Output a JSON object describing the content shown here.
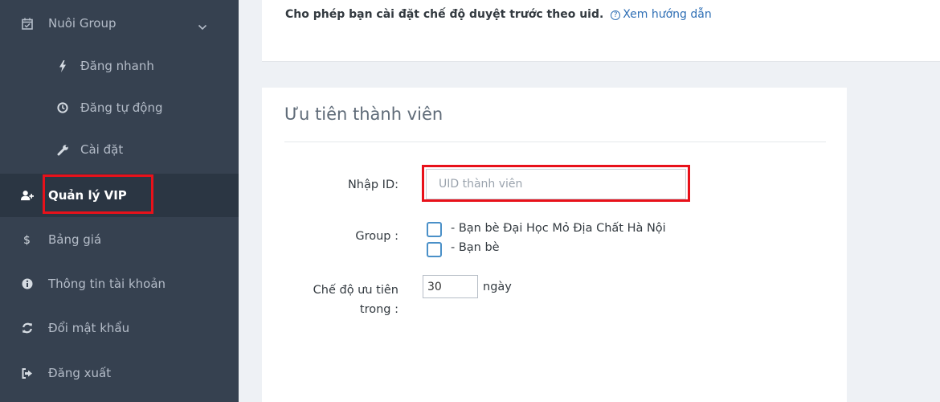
{
  "sidebar": {
    "group_menu": {
      "label": "Nuôi Group",
      "icon": "calendar-check-icon"
    },
    "sub_items": [
      {
        "label": "Đăng nhanh",
        "icon": "bolt-icon"
      },
      {
        "label": "Đăng tự động",
        "icon": "clock-icon"
      },
      {
        "label": "Cài đặt",
        "icon": "wrench-icon"
      }
    ],
    "active_item": {
      "label": "Quản lý VIP",
      "icon": "user-plus-icon"
    },
    "items": [
      {
        "label": "Bảng giá",
        "icon": "dollar-icon"
      },
      {
        "label": "Thông tin tài khoản",
        "icon": "info-circle-icon"
      },
      {
        "label": "Đổi mật khẩu",
        "icon": "refresh-icon"
      },
      {
        "label": "Đăng xuất",
        "icon": "sign-out-icon"
      }
    ]
  },
  "top_card": {
    "description": "Cho phép bạn cài đặt chế độ duyệt trước theo uid.",
    "help_link": "Xem hướng dẫn"
  },
  "form": {
    "title": "Ưu tiên thành viên",
    "id_label": "Nhập ID:",
    "id_placeholder": "UID thành viên",
    "group_label": "Group :",
    "groups": [
      {
        "label": "- Bạn bè Đại Học Mỏ Địa Chất Hà Nội",
        "checked": false
      },
      {
        "label": "- Bạn bè",
        "checked": false
      }
    ],
    "priority_label_line1": "Chế độ ưu tiên",
    "priority_label_line2": "trong :",
    "priority_value": "30",
    "priority_unit": "ngày"
  },
  "colors": {
    "sidebar_bg": "#364150",
    "sidebar_active_bg": "#2b3643",
    "highlight_red": "#e8111a",
    "link_blue": "#2f6fb5",
    "checkbox_blue": "#4a90c8"
  }
}
